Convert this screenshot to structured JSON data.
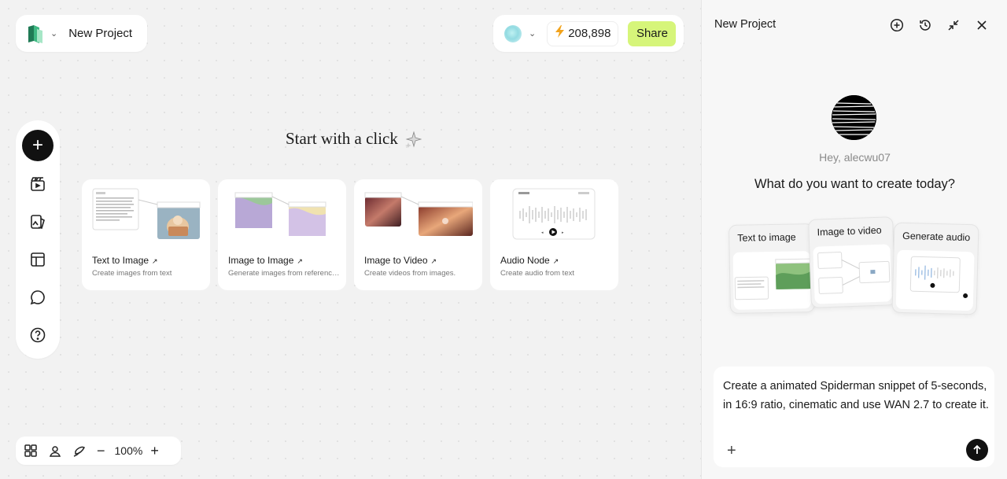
{
  "project": {
    "name": "New Project"
  },
  "toolbar": {
    "credits": "208,898",
    "share_label": "Share"
  },
  "canvas": {
    "heading": "Start with a click",
    "cards": [
      {
        "title": "Text to Image",
        "desc": "Create images from text"
      },
      {
        "title": "Image to Image",
        "desc": "Generate images from reference i..."
      },
      {
        "title": "Image to Video",
        "desc": "Create videos from images."
      },
      {
        "title": "Audio Node",
        "desc": "Create audio from text"
      }
    ],
    "zoom": "100%"
  },
  "panel": {
    "title": "New Project",
    "greeting": "Hey, alecwu07",
    "question": "What do you want to create today?",
    "features": [
      {
        "label": "Text to image"
      },
      {
        "label": "Image to video"
      },
      {
        "label": "Generate audio"
      }
    ],
    "chat": {
      "message": "Create a animated Spiderman snippet of 5-seconds, in 16:9 ratio, cinematic and use WAN 2.7 to create it."
    }
  },
  "colors": {
    "accent": "#d6f57a",
    "bolt": "#f2a31c",
    "dark": "#111111"
  }
}
